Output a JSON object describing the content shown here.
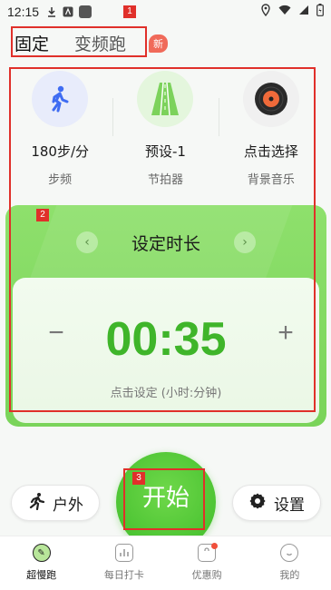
{
  "status_bar": {
    "time": "12:15"
  },
  "tabs": {
    "fixed": "固定",
    "variable": "变频跑",
    "new_badge": "新"
  },
  "presets": [
    {
      "value": "180步/分",
      "caption": "步频",
      "icon": "walking-person-icon"
    },
    {
      "value": "预设-1",
      "caption": "节拍器",
      "icon": "running-track-icon"
    },
    {
      "value": "点击选择",
      "caption": "背景音乐",
      "icon": "vinyl-record-icon"
    }
  ],
  "timer": {
    "title": "设定时长",
    "value": "00:35",
    "minus": "−",
    "plus": "+",
    "hint": "点击设定 (小时:分钟)"
  },
  "actions": {
    "outdoor": "户外",
    "start": "开始",
    "settings": "设置"
  },
  "nav": [
    {
      "label": "超慢跑",
      "active": true
    },
    {
      "label": "每日打卡",
      "active": false
    },
    {
      "label": "优惠购",
      "active": false
    },
    {
      "label": "我的",
      "active": false
    }
  ],
  "annotations": {
    "one": "1",
    "two": "2",
    "three": "3"
  },
  "colors": {
    "accent": "#4cc433",
    "timer_text": "#3fb52a",
    "annotation": "#e0302a",
    "badge": "#f06a5a"
  }
}
